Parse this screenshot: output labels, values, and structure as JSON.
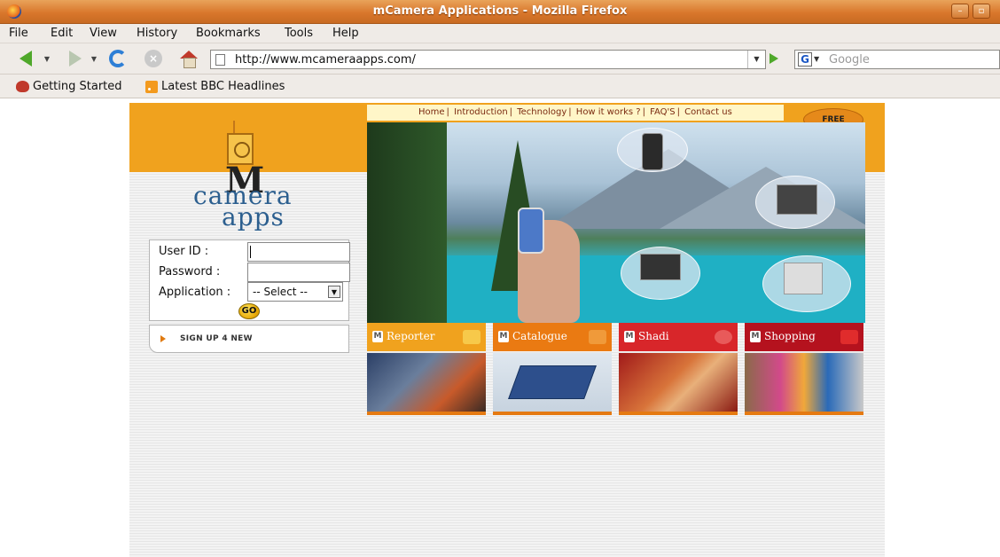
{
  "window": {
    "title": "mCamera Applications - Mozilla Firefox"
  },
  "menubar": {
    "items": [
      "File",
      "Edit",
      "View",
      "History",
      "Bookmarks",
      "Tools",
      "Help"
    ]
  },
  "navbar": {
    "url": "http://www.mcameraapps.com/",
    "search_placeholder": "Google",
    "search_engine_letter": "G"
  },
  "bookmarks": {
    "items": [
      "Getting Started",
      "Latest BBC Headlines"
    ]
  },
  "site": {
    "logo": {
      "m": "M",
      "line1": "camera",
      "line2": "apps"
    },
    "nav_links": [
      "Home",
      "Introduction",
      "Technology",
      "How it works ?",
      "FAQ'S",
      "Contact us"
    ],
    "free_download": "FREE DOWNLOAD",
    "login": {
      "user_label": "User ID :",
      "password_label": "Password :",
      "application_label": "Application :",
      "application_selected": "-- Select --",
      "go_label": "GO"
    },
    "signup_label": "SIGN UP 4 NEW",
    "categories": [
      {
        "label": "Reporter",
        "color": "#f0a21e"
      },
      {
        "label": "Catalogue",
        "color": "#ea7a12"
      },
      {
        "label": "Shadi",
        "color": "#d8262a"
      },
      {
        "label": "Shopping",
        "color": "#b5121e"
      }
    ]
  }
}
